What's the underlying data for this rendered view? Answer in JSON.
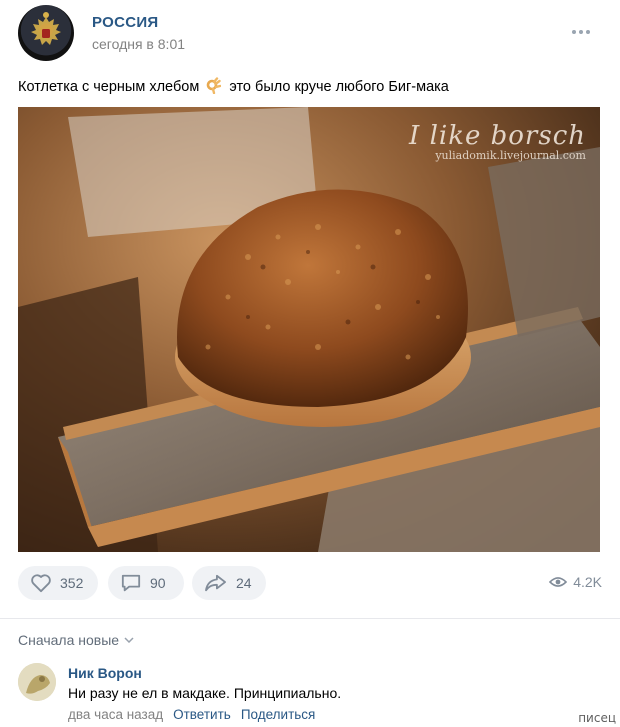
{
  "post": {
    "author": "РОССИЯ",
    "time": "сегодня в 8:01",
    "text_before_emoji": "Котлетка с черным хлебом",
    "text_after_emoji": "это было круче любого Биг-мака",
    "emoji": "ok-hand-emoji",
    "photo": {
      "subject": "cutlet-on-black-bread",
      "watermark_title": "I like borsch",
      "watermark_sub": "yuliadomik.livejournal.com"
    }
  },
  "actions": {
    "likes": "352",
    "comments": "90",
    "shares": "24",
    "views": "4.2K"
  },
  "comments_section": {
    "sort_label": "Сначала новые",
    "items": [
      {
        "author": "Ник Ворон",
        "text": "Ни разу не ел в макдаке. Принципиально.",
        "time": "два часа назад",
        "reply_label": "Ответить",
        "share_label": "Поделиться"
      }
    ]
  },
  "site_mark": "писец",
  "colors": {
    "link_blue": "#2a5885",
    "meta_gray": "#828282",
    "button_bg": "#f0f2f5",
    "icon_gray": "#818c99"
  }
}
